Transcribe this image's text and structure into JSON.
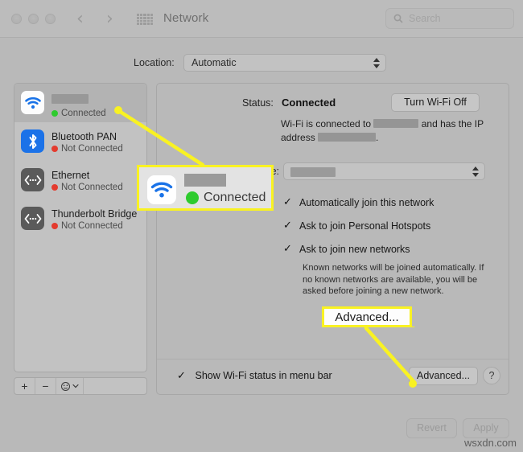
{
  "window": {
    "title": "Network",
    "traffic_lights": [
      "close",
      "minimize",
      "zoom"
    ],
    "nav_back_icon": "chevron-left-icon",
    "nav_forward_icon": "chevron-right-icon",
    "grid_icon": "grid-apps-icon"
  },
  "search": {
    "placeholder": "Search",
    "icon": "search-icon"
  },
  "location": {
    "label": "Location:",
    "value": "Automatic"
  },
  "sidebar": {
    "items": [
      {
        "name": "",
        "name_redacted": true,
        "status": "Connected",
        "status_color": "#2ecb2e",
        "icon": "wifi-icon",
        "selected": true
      },
      {
        "name": "Bluetooth PAN",
        "name_redacted": false,
        "status": "Not Connected",
        "status_color": "#e43b2e",
        "icon": "bluetooth-icon",
        "selected": false
      },
      {
        "name": "Ethernet",
        "name_redacted": false,
        "status": "Not Connected",
        "status_color": "#e43b2e",
        "icon": "ethernet-icon",
        "selected": false
      },
      {
        "name": "Thunderbolt Bridge",
        "name_redacted": false,
        "status": "Not Connected",
        "status_color": "#e43b2e",
        "icon": "ethernet-icon",
        "selected": false
      }
    ],
    "toolbar": {
      "add": "+",
      "remove": "−",
      "actions": "⚙",
      "actions_chevron": "chevron-down-icon"
    }
  },
  "detail": {
    "status_label": "Status:",
    "status_value": "Connected",
    "wifi_toggle_button": "Turn Wi-Fi Off",
    "status_description_prefix": "Wi-Fi is connected to",
    "status_description_middle": "and has the IP",
    "status_description_suffix": "address",
    "network_name_label": "Network Name:",
    "network_name_value": "",
    "checkboxes": [
      {
        "label": "Automatically join this network",
        "checked": true
      },
      {
        "label": "Ask to join Personal Hotspots",
        "checked": true
      },
      {
        "label": "Ask to join new networks",
        "checked": true
      }
    ],
    "checkbox_note": "Known networks will be joined automatically. If no known networks are available, you will be asked before joining a new network.",
    "show_status_checkbox": {
      "label": "Show Wi-Fi status in menu bar",
      "checked": true
    },
    "advanced_button": "Advanced...",
    "help_button": "?"
  },
  "footer": {
    "revert_button": "Revert",
    "apply_button": "Apply"
  },
  "annotations": {
    "callout_connected": {
      "status_text": "Connected",
      "icon": "wifi-icon",
      "border_color": "#f9f222"
    },
    "callout_advanced": {
      "text": "Advanced...",
      "border_color": "#f9f222"
    },
    "arrow_color": "#f9f222"
  },
  "watermark": "wsxdn.com"
}
